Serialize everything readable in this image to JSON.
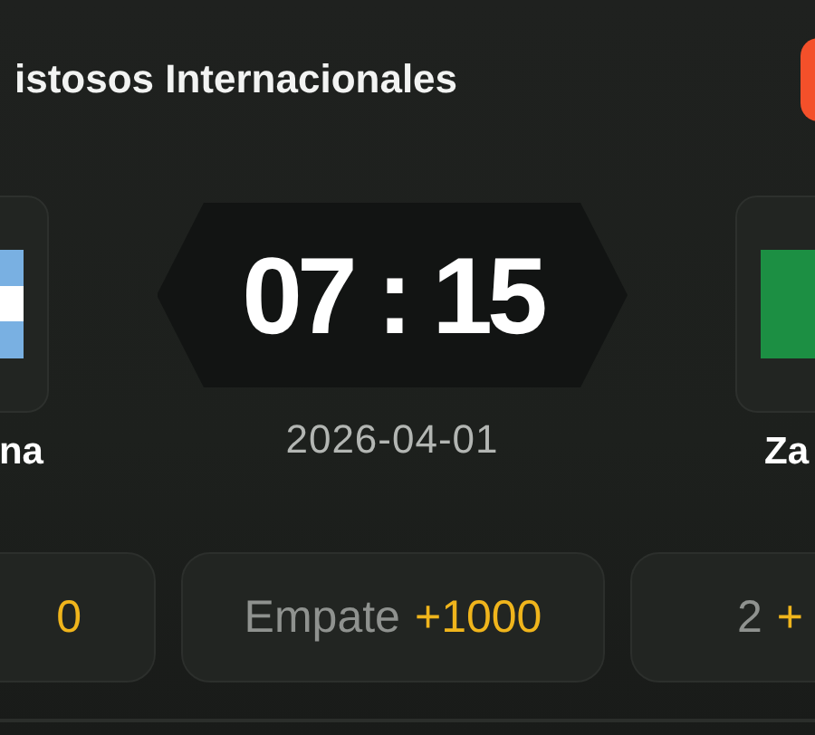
{
  "header": {
    "title": "istosos Internacionales"
  },
  "match": {
    "home": {
      "name": "na",
      "kind": "stripes"
    },
    "away": {
      "name": "Za",
      "kind": "green"
    },
    "time": "07 : 15",
    "date": "2026-04-01"
  },
  "odds": [
    {
      "odds": "0"
    },
    {
      "label": "Empate",
      "odds": "+1000"
    },
    {
      "label": "2",
      "odds": "+"
    }
  ]
}
